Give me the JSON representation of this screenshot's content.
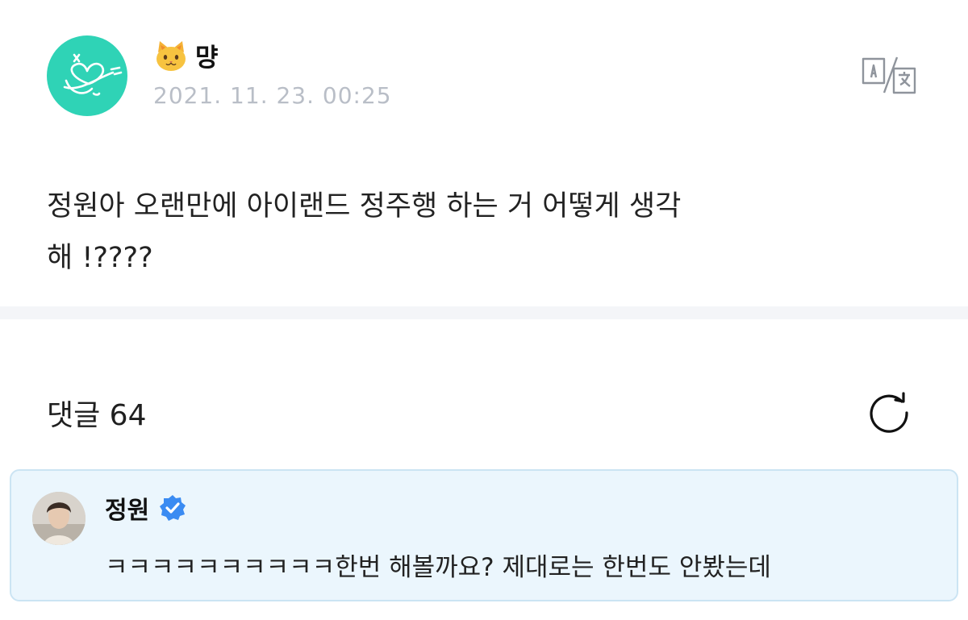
{
  "post": {
    "author": {
      "emoji_icon": "cat-face-icon",
      "name": "먕"
    },
    "timestamp": "2021. 11. 23. 00:25",
    "translate_icon": "translate-icon",
    "body_line1": "정원아 오랜만에 아이랜드 정주행 하는 거 어떻게 생각",
    "body_line2": "해 !????"
  },
  "comments": {
    "header": "댓글 64",
    "refresh_icon": "refresh-icon",
    "highlighted": {
      "author": "정원",
      "verified_icon": "verified-badge-icon",
      "text": "ㅋㅋㅋㅋㅋㅋㅋㅋㅋㅋ한번 해볼까요? 제대로는 한번도 안봤는데"
    }
  },
  "colors": {
    "avatar_bg": "#2fd3b6",
    "timestamp": "#b9bec7",
    "comment_bg": "#ebf6fd",
    "comment_border": "#cbe4f3",
    "verified": "#3a8bf2"
  }
}
